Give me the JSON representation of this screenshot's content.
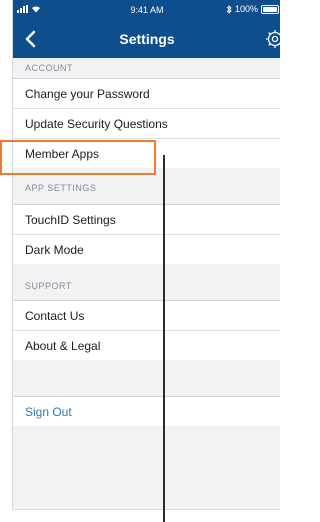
{
  "status_bar": {
    "time": "9:41 AM",
    "battery_text": "100%",
    "battery_level": 1.0
  },
  "nav": {
    "title": "Settings",
    "back_icon": "chevron-left-icon",
    "settings_icon": "gear-icon"
  },
  "sections": {
    "account": {
      "header": "ACCOUNT",
      "items": [
        "Change your Password",
        "Update Security Questions",
        "Member Apps"
      ]
    },
    "app_settings": {
      "header": "APP SETTINGS",
      "items": [
        "TouchID Settings",
        "Dark Mode"
      ]
    },
    "support": {
      "header": "SUPPORT",
      "items": [
        "Contact Us",
        "About & Legal"
      ]
    }
  },
  "sign_out": "Sign Out",
  "colors": {
    "header_bg": "#0f4e8c",
    "accent_link": "#2a7ac0",
    "annotation": "#ef7b31"
  }
}
